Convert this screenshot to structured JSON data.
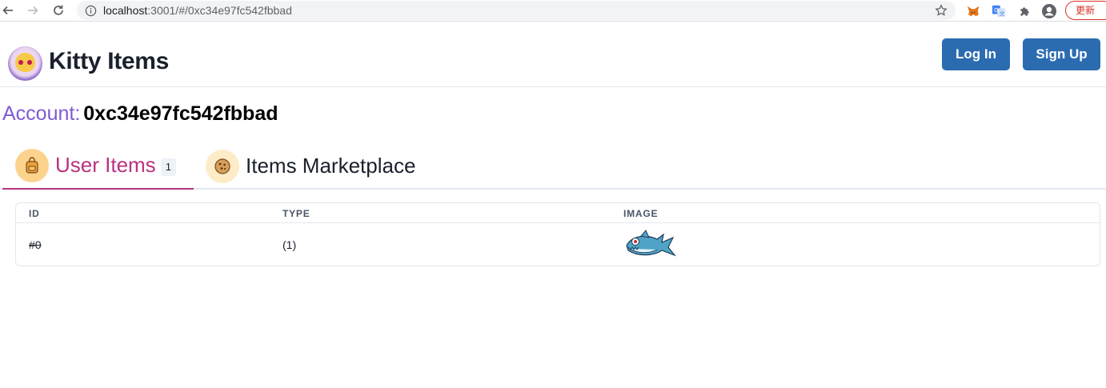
{
  "browser": {
    "url_host": "localhost",
    "url_rest": ":3001/#/0xc34e97fc542fbbad",
    "update_label": "更新"
  },
  "header": {
    "app_title": "Kitty Items",
    "login_label": "Log In",
    "signup_label": "Sign Up",
    "accent_color": "#2b6cb0"
  },
  "account": {
    "label": "Account:",
    "address": "0xc34e97fc542fbbad"
  },
  "tabs": [
    {
      "label": "User Items",
      "badge": "1",
      "icon": "backpack-icon",
      "active": true
    },
    {
      "label": "Items Marketplace",
      "icon": "cookie-icon",
      "active": false
    }
  ],
  "table": {
    "columns": [
      "ID",
      "TYPE",
      "IMAGE"
    ],
    "rows": [
      {
        "id": "#0",
        "type": "(1)",
        "image": "shark-icon"
      }
    ]
  }
}
